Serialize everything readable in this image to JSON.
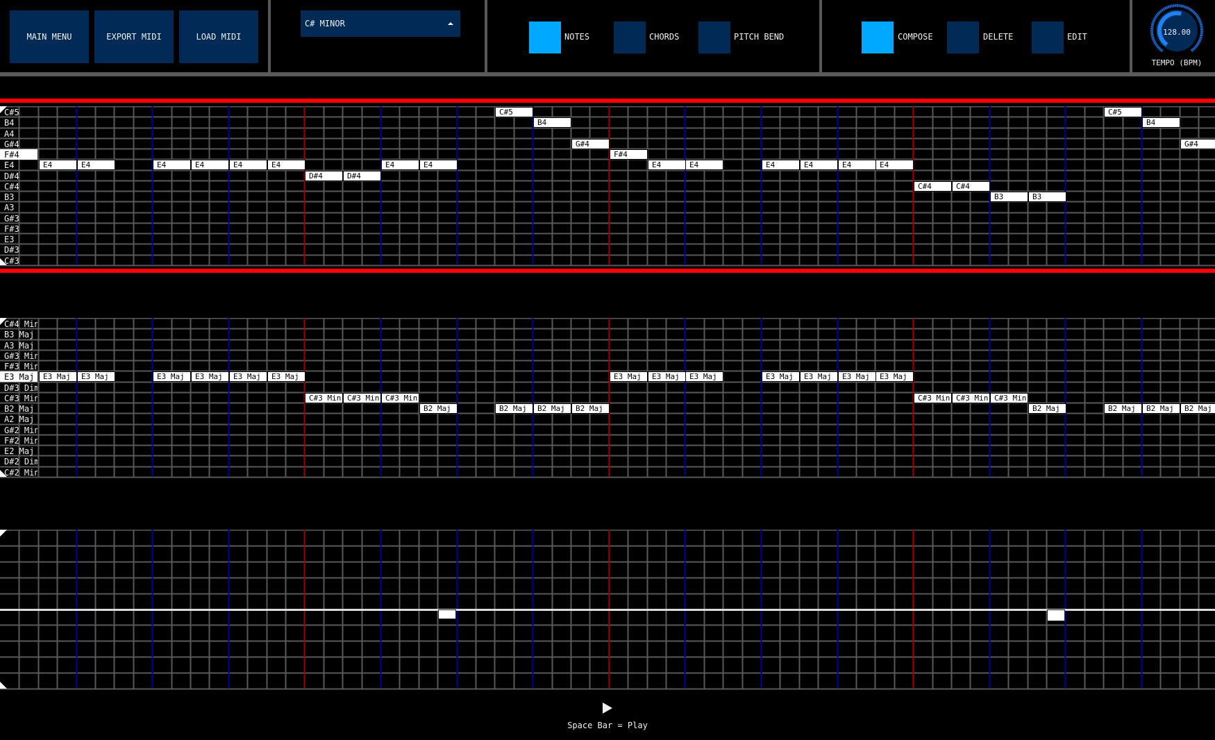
{
  "toolbar": {
    "buttons": [
      {
        "label": "MAIN MENU"
      },
      {
        "label": "EXPORT MIDI"
      },
      {
        "label": "LOAD MIDI"
      }
    ],
    "scale_dropdown": {
      "selected": "C# MINOR"
    },
    "view_toggles": [
      {
        "label": "NOTES",
        "active": true
      },
      {
        "label": "CHORDS",
        "active": false
      },
      {
        "label": "PITCH BEND",
        "active": false
      }
    ],
    "mode_toggles": [
      {
        "label": "COMPOSE",
        "active": true
      },
      {
        "label": "DELETE",
        "active": false
      },
      {
        "label": "EDIT",
        "active": false
      }
    ],
    "tempo": {
      "value": "128.00",
      "label": "TEMPO (BPM)",
      "fraction": 0.55
    }
  },
  "colors": {
    "active": "#00a8ff",
    "inactive": "#012a57",
    "grid_line": "#595959",
    "beat_line": "#0000a0",
    "bar_line": "#a00000",
    "playhead_bar": "#ff0000"
  },
  "notes_grid": {
    "rows": [
      "C#5",
      "B4",
      "A4",
      "G#4",
      "F#4",
      "E4",
      "D#4",
      "C#4",
      "B3",
      "A3",
      "G#3",
      "F#3",
      "E3",
      "D#3",
      "C#3"
    ],
    "highlighted_row": "F#4",
    "notes": [
      {
        "pitch": "E4",
        "slot": 1
      },
      {
        "pitch": "E4",
        "slot": 2
      },
      {
        "pitch": "E4",
        "slot": 4
      },
      {
        "pitch": "E4",
        "slot": 5
      },
      {
        "pitch": "E4",
        "slot": 6
      },
      {
        "pitch": "E4",
        "slot": 7
      },
      {
        "pitch": "D#4",
        "slot": 8
      },
      {
        "pitch": "D#4",
        "slot": 9
      },
      {
        "pitch": "E4",
        "slot": 10
      },
      {
        "pitch": "E4",
        "slot": 11
      },
      {
        "pitch": "C#5",
        "slot": 13
      },
      {
        "pitch": "B4",
        "slot": 14
      },
      {
        "pitch": "G#4",
        "slot": 15
      },
      {
        "pitch": "F#4",
        "slot": 16
      },
      {
        "pitch": "E4",
        "slot": 17
      },
      {
        "pitch": "E4",
        "slot": 18
      },
      {
        "pitch": "E4",
        "slot": 20
      },
      {
        "pitch": "E4",
        "slot": 21
      },
      {
        "pitch": "E4",
        "slot": 22
      },
      {
        "pitch": "E4",
        "slot": 23
      },
      {
        "pitch": "C#4",
        "slot": 24
      },
      {
        "pitch": "C#4",
        "slot": 25
      },
      {
        "pitch": "B3",
        "slot": 26
      },
      {
        "pitch": "B3",
        "slot": 27
      },
      {
        "pitch": "C#5",
        "slot": 29
      },
      {
        "pitch": "B4",
        "slot": 30
      },
      {
        "pitch": "G#4",
        "slot": 31
      }
    ]
  },
  "chords_grid": {
    "rows": [
      "C#4 Min",
      "B3 Maj",
      "A3 Maj",
      "G#3 Min",
      "F#3 Min",
      "E3 Maj",
      "D#3 Dim",
      "C#3 Min",
      "B2 Maj",
      "A2 Maj",
      "G#2 Min",
      "F#2 Min",
      "E2 Maj",
      "D#2 Dim",
      "C#2 Min"
    ],
    "highlighted_row": "E3 Maj",
    "chords": [
      {
        "chord": "E3 Maj",
        "slot": 1
      },
      {
        "chord": "E3 Maj",
        "slot": 2
      },
      {
        "chord": "E3 Maj",
        "slot": 4
      },
      {
        "chord": "E3 Maj",
        "slot": 5
      },
      {
        "chord": "E3 Maj",
        "slot": 6
      },
      {
        "chord": "E3 Maj",
        "slot": 7
      },
      {
        "chord": "C#3 Min",
        "slot": 8
      },
      {
        "chord": "C#3 Min",
        "slot": 9
      },
      {
        "chord": "C#3 Min",
        "slot": 10
      },
      {
        "chord": "B2 Maj",
        "slot": 11
      },
      {
        "chord": "B2 Maj",
        "slot": 13
      },
      {
        "chord": "B2 Maj",
        "slot": 14
      },
      {
        "chord": "B2 Maj",
        "slot": 15
      },
      {
        "chord": "E3 Maj",
        "slot": 16
      },
      {
        "chord": "E3 Maj",
        "slot": 17
      },
      {
        "chord": "E3 Maj",
        "slot": 18
      },
      {
        "chord": "E3 Maj",
        "slot": 20
      },
      {
        "chord": "E3 Maj",
        "slot": 21
      },
      {
        "chord": "E3 Maj",
        "slot": 22
      },
      {
        "chord": "E3 Maj",
        "slot": 23
      },
      {
        "chord": "C#3 Min",
        "slot": 24
      },
      {
        "chord": "C#3 Min",
        "slot": 25
      },
      {
        "chord": "C#3 Min",
        "slot": 26
      },
      {
        "chord": "B2 Maj",
        "slot": 27
      },
      {
        "chord": "B2 Maj",
        "slot": 29
      },
      {
        "chord": "B2 Maj",
        "slot": 30
      },
      {
        "chord": "B2 Maj",
        "slot": 31
      }
    ]
  },
  "pitch_bend": {
    "rows": 10,
    "markers": [
      {
        "step": 23,
        "value": -0.1
      },
      {
        "step": 55,
        "value": -0.15
      }
    ]
  },
  "footer": {
    "play_hint": "Space Bar = Play"
  }
}
